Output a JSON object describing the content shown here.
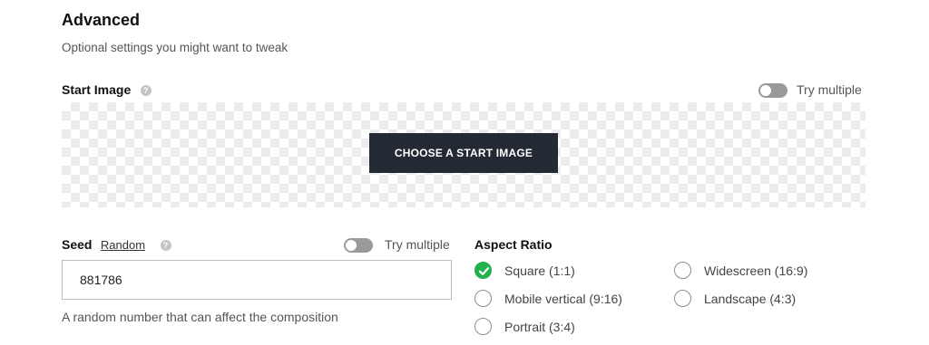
{
  "advanced": {
    "title": "Advanced",
    "subtitle": "Optional settings you might want to tweak"
  },
  "start_image": {
    "label": "Start Image",
    "help_icon": "?",
    "try_multiple_label": "Try multiple",
    "try_multiple_enabled": false,
    "button_label": "CHOOSE A START IMAGE"
  },
  "seed": {
    "label": "Seed",
    "random_link": "Random",
    "help_icon": "?",
    "try_multiple_label": "Try multiple",
    "try_multiple_enabled": false,
    "value": "881786",
    "help_text": "A random number that can affect the composition"
  },
  "aspect_ratio": {
    "label": "Aspect Ratio",
    "selected": "Square (1:1)",
    "options": [
      {
        "label": "Square (1:1)",
        "checked": true
      },
      {
        "label": "Widescreen (16:9)",
        "checked": false
      },
      {
        "label": "Mobile vertical (9:16)",
        "checked": false
      },
      {
        "label": "Landscape (4:3)",
        "checked": false
      },
      {
        "label": "Portrait (3:4)",
        "checked": false
      }
    ],
    "check_color": "#22b14c"
  }
}
